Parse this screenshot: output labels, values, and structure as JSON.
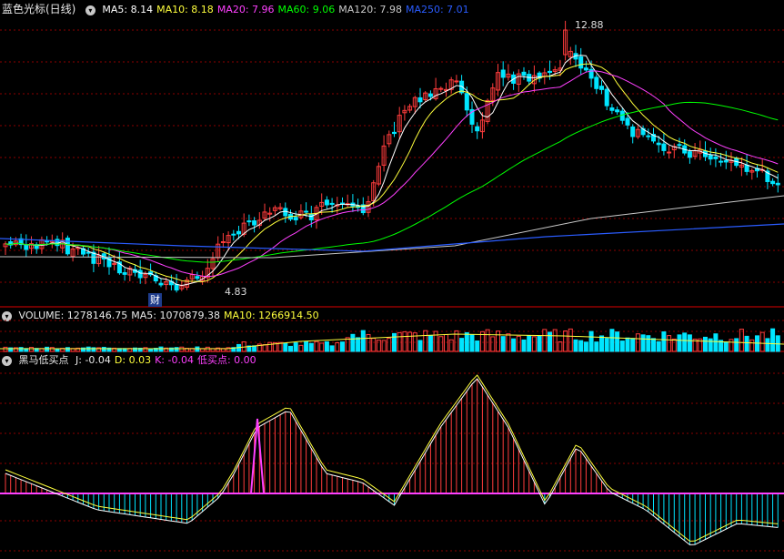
{
  "price_panel": {
    "title": "蓝色光标(日线)",
    "ma": [
      {
        "label": "MA5: 8.14",
        "color": "#ffffff"
      },
      {
        "label": "MA10: 8.18",
        "color": "#ffff3c"
      },
      {
        "label": "MA20: 7.96",
        "color": "#ff40ff"
      },
      {
        "label": "MA60: 9.06",
        "color": "#00ff00"
      },
      {
        "label": "MA120: 7.98",
        "color": "#c8c8c8"
      },
      {
        "label": "MA250: 7.01",
        "color": "#2a5cff"
      }
    ],
    "high_label": "12.88",
    "low_label": "4.83",
    "event_mark": "财"
  },
  "volume_panel": {
    "items": [
      {
        "label": "VOLUME: 1278146.75",
        "color": "#e8e8e8"
      },
      {
        "label": "MA5: 1070879.38",
        "color": "#e8e8e8"
      },
      {
        "label": "MA10: 1266914.50",
        "color": "#ffff3c"
      }
    ]
  },
  "indicator_panel": {
    "title": "黑马低买点",
    "items": [
      {
        "label": "J: -0.04",
        "color": "#e8e8e8"
      },
      {
        "label": "D: 0.03",
        "color": "#ffff3c"
      },
      {
        "label": "K: -0.04",
        "color": "#ff40ff"
      },
      {
        "label": "低买点: 0.00",
        "color": "#ff40ff"
      }
    ]
  },
  "colors": {
    "up": "#ff3c3c",
    "down": "#00e5ff",
    "grid": "#8b0000",
    "divider": "#b00000"
  }
}
